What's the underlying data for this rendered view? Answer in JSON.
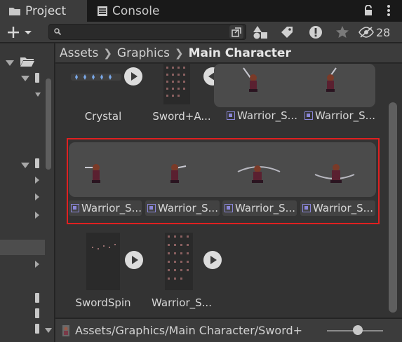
{
  "tabs": [
    {
      "label": "Project",
      "icon": "folder-icon",
      "active": true
    },
    {
      "label": "Console",
      "icon": "console-icon",
      "active": false
    }
  ],
  "toolbar": {
    "search_value": "",
    "hidden_count": "28"
  },
  "breadcrumb": [
    "Assets",
    "Graphics",
    "Main Character"
  ],
  "assets": [
    {
      "name": "Crystal",
      "type": "sprite-sheet"
    },
    {
      "name": "Sword+A...",
      "type": "sprite-sheet"
    },
    {
      "name": "Warrior_S...",
      "type": "sub-sprite"
    },
    {
      "name": "Warrior_S...",
      "type": "sub-sprite"
    },
    {
      "name": "Warrior_S...",
      "type": "sub-sprite"
    },
    {
      "name": "Warrior_S...",
      "type": "sub-sprite"
    },
    {
      "name": "Warrior_S...",
      "type": "sub-sprite"
    },
    {
      "name": "Warrior_S...",
      "type": "sub-sprite"
    },
    {
      "name": "SwordSpin",
      "type": "sprite-sheet"
    },
    {
      "name": "Warrior_S...",
      "type": "sprite-sheet"
    }
  ],
  "status": {
    "path": "Assets/Graphics/Main Character/Sword+"
  },
  "colors": {
    "highlight": "#e02020",
    "subasset_icon": "#8a86d8",
    "panel": "#3c3c3c",
    "grid_bg": "#333333"
  }
}
